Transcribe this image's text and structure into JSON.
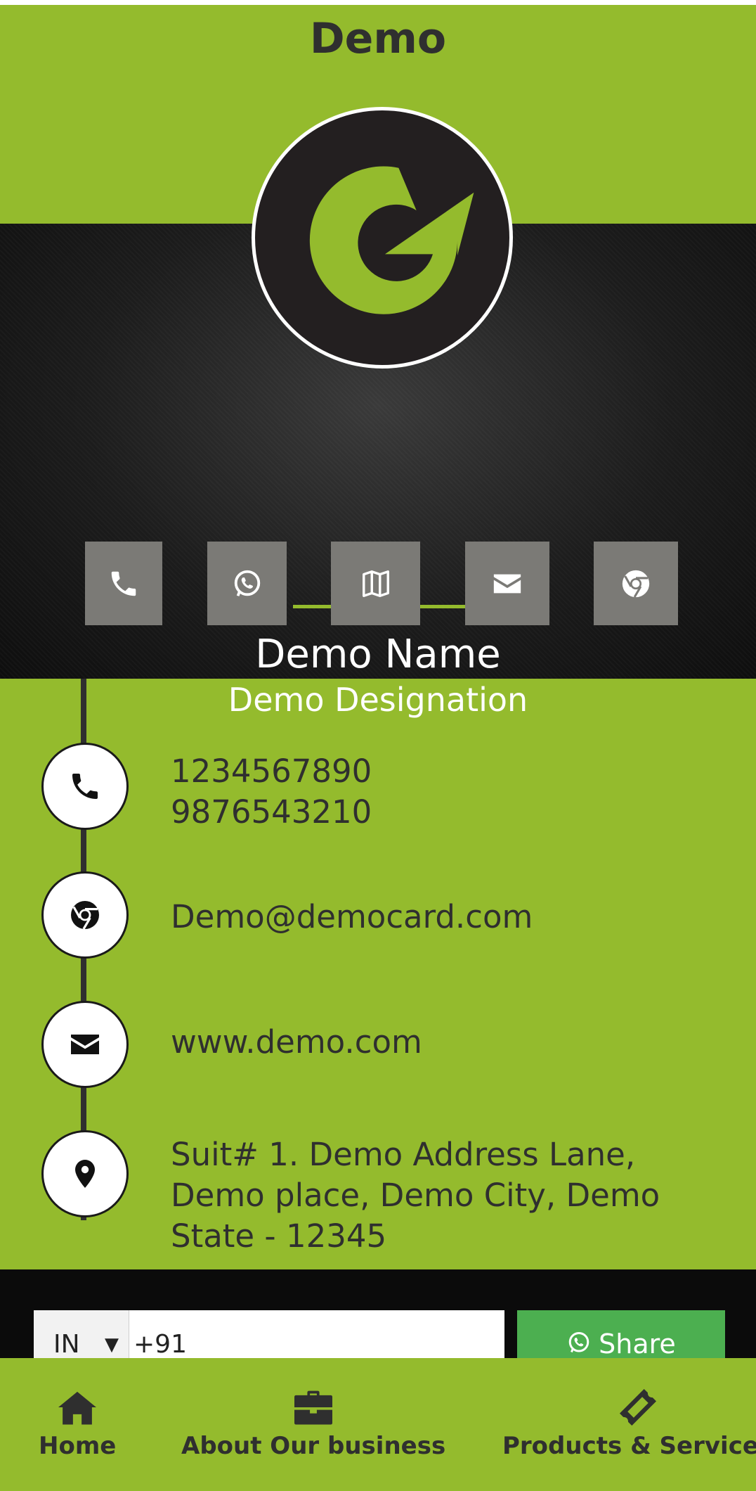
{
  "header": {
    "title": "Demo"
  },
  "profile": {
    "name": "Demo Name",
    "designation": "Demo Designation"
  },
  "quick_actions": [
    {
      "icon": "phone-icon"
    },
    {
      "icon": "whatsapp-icon"
    },
    {
      "icon": "map-icon"
    },
    {
      "icon": "envelope-icon"
    },
    {
      "icon": "chrome-icon"
    }
  ],
  "contacts": {
    "phone_1": "1234567890",
    "phone_2": "9876543210",
    "email": "Demo@democard.com",
    "website": "www.demo.com",
    "address_line_1": "Suit# 1. Demo Address Lane,",
    "address_line_2": "Demo place, Demo City, Demo",
    "address_line_3": "State - 12345"
  },
  "share": {
    "country": "IN",
    "phone_value": "+91",
    "button_label": "Share"
  },
  "bottom_nav": {
    "home": "Home",
    "about": "About Our business",
    "products": "Products & Services"
  },
  "colors": {
    "brand_green": "#94bb2d",
    "dark_text": "#2f2f2f",
    "share_green": "#4caf50",
    "button_gray": "#7b7a76"
  }
}
